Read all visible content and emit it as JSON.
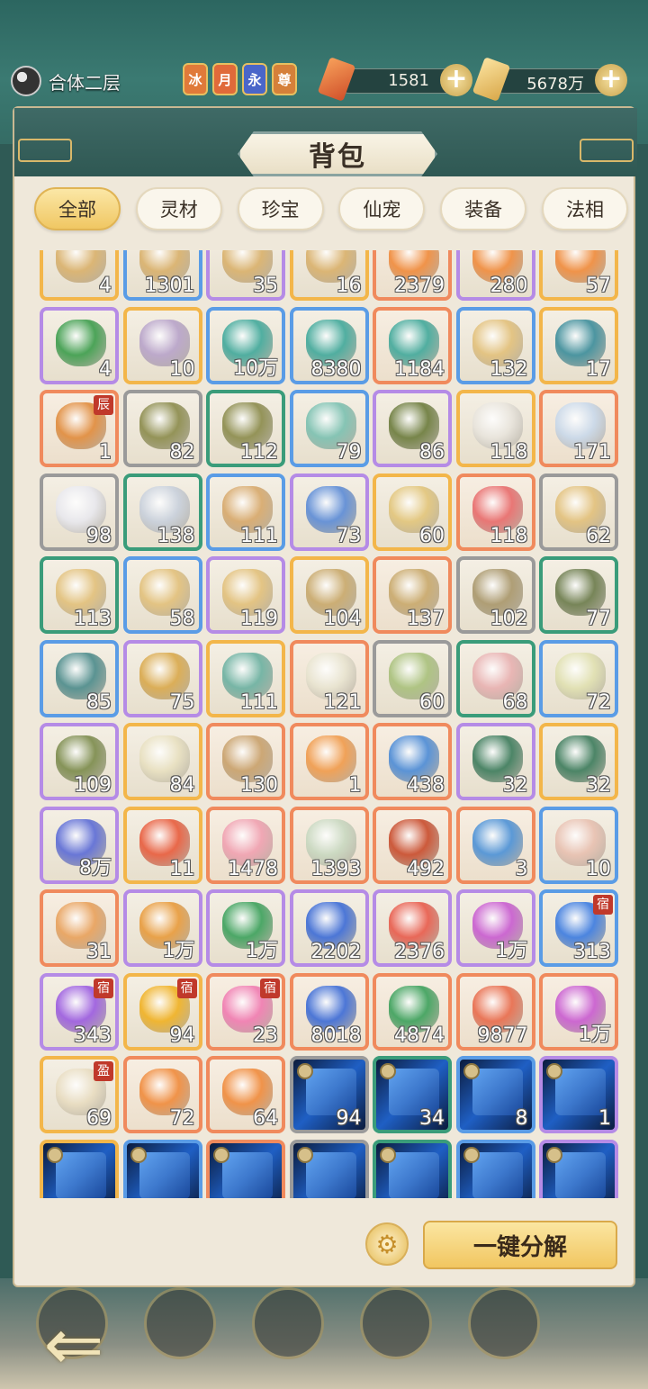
{
  "header": {
    "realm_label": "合体二层",
    "badges": [
      {
        "text": "冰",
        "color": "#e07a3a"
      },
      {
        "text": "月",
        "color": "#e06a3a"
      },
      {
        "text": "永",
        "color": "#4a66c9"
      },
      {
        "text": "尊",
        "color": "#d5803a"
      }
    ],
    "currency_1": {
      "icon": "red-gem-icon",
      "value": "1581",
      "color": "#e46a3a"
    },
    "currency_2": {
      "icon": "gold-ticket-icon",
      "value": "5678万",
      "color": "#e8b856"
    }
  },
  "panel": {
    "title": "背包",
    "tabs": [
      "全部",
      "灵材",
      "珍宝",
      "仙宠",
      "装备",
      "法相"
    ],
    "active_tab": "全部",
    "decompose_label": "一键分解"
  },
  "items": [
    {
      "q": "4",
      "r": "gold",
      "c": "#d9b06a"
    },
    {
      "q": "1301",
      "r": "blue",
      "c": "#d9b06a"
    },
    {
      "q": "35",
      "r": "purple",
      "c": "#d9b06a"
    },
    {
      "q": "16",
      "r": "gold",
      "c": "#d9b06a"
    },
    {
      "q": "2379",
      "r": "orange",
      "c": "#f08a3a"
    },
    {
      "q": "280",
      "r": "purple",
      "c": "#f08a3a"
    },
    {
      "q": "57",
      "r": "gold",
      "c": "#f08a3a"
    },
    {
      "q": "4",
      "r": "purple",
      "c": "#3a9c4a"
    },
    {
      "q": "10",
      "r": "gold",
      "c": "#b7a2c9"
    },
    {
      "q": "10万",
      "r": "blue",
      "c": "#3fa89a"
    },
    {
      "q": "8380",
      "r": "blue",
      "c": "#3fa89a"
    },
    {
      "q": "1184",
      "r": "orange",
      "c": "#3fa89a"
    },
    {
      "q": "132",
      "r": "blue",
      "c": "#e2c07a"
    },
    {
      "q": "17",
      "r": "gold",
      "c": "#3a8c9a"
    },
    {
      "q": "1",
      "r": "orange",
      "c": "#e08a3a",
      "tag": "辰"
    },
    {
      "q": "82",
      "r": "gray",
      "c": "#8a8a4a"
    },
    {
      "q": "112",
      "r": "green",
      "c": "#8a8a4a"
    },
    {
      "q": "79",
      "r": "blue",
      "c": "#7ac0b0"
    },
    {
      "q": "86",
      "r": "purple",
      "c": "#6a7a3a"
    },
    {
      "q": "118",
      "r": "gold",
      "c": "#e8e4dc"
    },
    {
      "q": "171",
      "r": "orange",
      "c": "#c8d8ea"
    },
    {
      "q": "98",
      "r": "gray",
      "c": "#e8e8ee"
    },
    {
      "q": "138",
      "r": "green",
      "c": "#c8d0dc"
    },
    {
      "q": "111",
      "r": "blue",
      "c": "#d7a86a"
    },
    {
      "q": "73",
      "r": "purple",
      "c": "#5a8ad6"
    },
    {
      "q": "60",
      "r": "gold",
      "c": "#e2c57a"
    },
    {
      "q": "118",
      "r": "orange",
      "c": "#e86a6a"
    },
    {
      "q": "62",
      "r": "gray",
      "c": "#e2c07a"
    },
    {
      "q": "113",
      "r": "green",
      "c": "#e2c07a"
    },
    {
      "q": "58",
      "r": "blue",
      "c": "#e2c07a"
    },
    {
      "q": "119",
      "r": "purple",
      "c": "#e2c07a"
    },
    {
      "q": "104",
      "r": "gold",
      "c": "#c8a86a"
    },
    {
      "q": "137",
      "r": "orange",
      "c": "#c8a86a"
    },
    {
      "q": "102",
      "r": "gray",
      "c": "#a8966a"
    },
    {
      "q": "77",
      "r": "green",
      "c": "#6a7a4a"
    },
    {
      "q": "85",
      "r": "blue",
      "c": "#4a8a8a"
    },
    {
      "q": "75",
      "r": "purple",
      "c": "#d9a84a"
    },
    {
      "q": "111",
      "r": "gold",
      "c": "#6ab0a0"
    },
    {
      "q": "121",
      "r": "orange",
      "c": "#e8e4d0"
    },
    {
      "q": "60",
      "r": "gray",
      "c": "#a8c07a"
    },
    {
      "q": "68",
      "r": "green",
      "c": "#e8b0b0"
    },
    {
      "q": "72",
      "r": "blue",
      "c": "#e0e0b0"
    },
    {
      "q": "109",
      "r": "purple",
      "c": "#7a8a4a"
    },
    {
      "q": "84",
      "r": "gold",
      "c": "#e8e0c0"
    },
    {
      "q": "130",
      "r": "orange",
      "c": "#c8a06a"
    },
    {
      "q": "1",
      "r": "orange",
      "c": "#f09a4a"
    },
    {
      "q": "438",
      "r": "orange",
      "c": "#4a8ad6"
    },
    {
      "q": "32",
      "r": "purple",
      "c": "#3a7a5a"
    },
    {
      "q": "32",
      "r": "gold",
      "c": "#3a7a5a"
    },
    {
      "q": "8万",
      "r": "purple",
      "c": "#5a6ad6"
    },
    {
      "q": "11",
      "r": "gold",
      "c": "#e85a3a"
    },
    {
      "q": "1478",
      "r": "orange",
      "c": "#f0a0b0"
    },
    {
      "q": "1393",
      "r": "orange",
      "c": "#c8d8c0"
    },
    {
      "q": "492",
      "r": "orange",
      "c": "#c84a2a"
    },
    {
      "q": "3",
      "r": "orange",
      "c": "#4a90d6"
    },
    {
      "q": "10",
      "r": "blue",
      "c": "#e8c0b0"
    },
    {
      "q": "31",
      "r": "orange",
      "c": "#e8a05a"
    },
    {
      "q": "1万",
      "r": "purple",
      "c": "#e89a3a"
    },
    {
      "q": "1万",
      "r": "purple",
      "c": "#3aa05a"
    },
    {
      "q": "2202",
      "r": "purple",
      "c": "#3a6ad6"
    },
    {
      "q": "2376",
      "r": "purple",
      "c": "#e85a4a"
    },
    {
      "q": "1万",
      "r": "purple",
      "c": "#c85ad0"
    },
    {
      "q": "313",
      "r": "blue",
      "c": "#3a7ae0",
      "tag": "宿"
    },
    {
      "q": "343",
      "r": "purple",
      "c": "#9a5ae0",
      "tag": "宿"
    },
    {
      "q": "94",
      "r": "gold",
      "c": "#f0b020",
      "tag": "宿"
    },
    {
      "q": "23",
      "r": "orange",
      "c": "#f07ab0",
      "tag": "宿"
    },
    {
      "q": "8018",
      "r": "orange",
      "c": "#3a6ad6"
    },
    {
      "q": "4874",
      "r": "orange",
      "c": "#3aa05a"
    },
    {
      "q": "9877",
      "r": "orange",
      "c": "#e86a4a"
    },
    {
      "q": "1万",
      "r": "orange",
      "c": "#c85ad0"
    },
    {
      "q": "69",
      "r": "gold",
      "c": "#e8dcc0",
      "tag": "盈"
    },
    {
      "q": "72",
      "r": "orange",
      "c": "#f08a3a"
    },
    {
      "q": "64",
      "r": "orange",
      "c": "#f08a3a"
    },
    {
      "q": "94",
      "r": "gray",
      "c": "#1a4aa0",
      "dark": true,
      "lock": true
    },
    {
      "q": "34",
      "r": "green",
      "c": "#1a4aa0",
      "dark": true,
      "lock": true
    },
    {
      "q": "8",
      "r": "blue",
      "c": "#1a4aa0",
      "dark": true,
      "lock": true
    },
    {
      "q": "1",
      "r": "purple",
      "c": "#1a4aa0",
      "dark": true,
      "lock": true
    },
    {
      "q": "",
      "r": "gold",
      "c": "#1a4aa0",
      "dark": true,
      "lock": true
    },
    {
      "q": "",
      "r": "blue",
      "c": "#1a4aa0",
      "dark": true,
      "lock": true
    },
    {
      "q": "",
      "r": "orange",
      "c": "#1a4aa0",
      "dark": true,
      "lock": true
    },
    {
      "q": "",
      "r": "gray",
      "c": "#1a4aa0",
      "dark": true,
      "lock": true
    },
    {
      "q": "",
      "r": "green",
      "c": "#1a4aa0",
      "dark": true,
      "lock": true
    },
    {
      "q": "",
      "r": "blue",
      "c": "#1a4aa0",
      "dark": true,
      "lock": true
    },
    {
      "q": "",
      "r": "purple",
      "c": "#1a4aa0",
      "dark": true,
      "lock": true
    }
  ]
}
